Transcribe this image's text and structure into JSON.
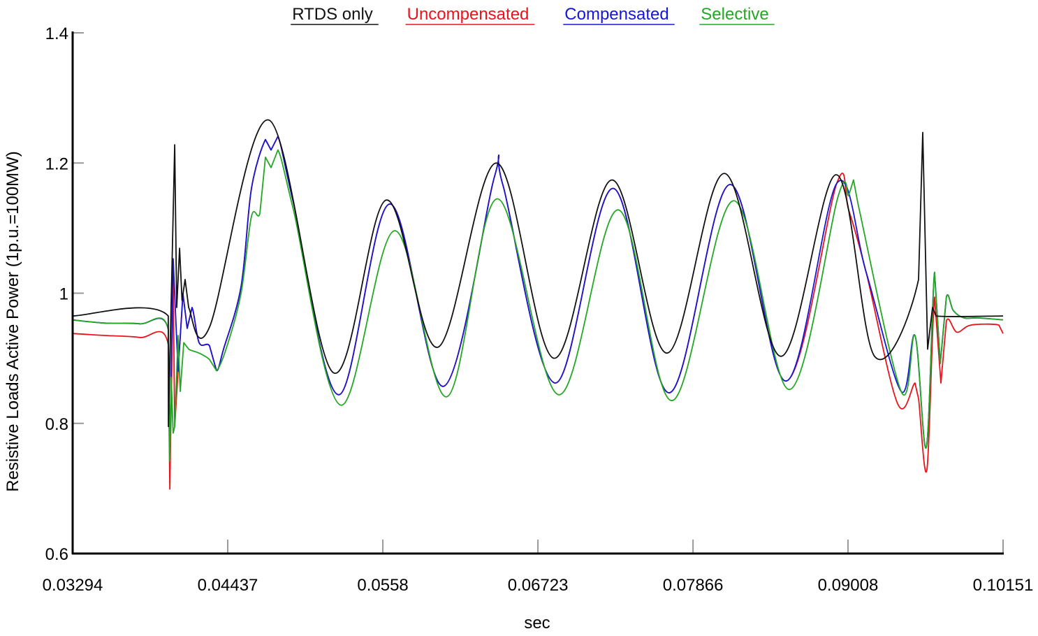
{
  "chart_data": {
    "type": "line",
    "title": "",
    "xlabel": "sec",
    "ylabel": "Resistive Loads Active Power (1p.u.=100MW)",
    "xlim": [
      0.03294,
      0.10151
    ],
    "ylim": [
      0.6,
      1.4
    ],
    "x_ticks": [
      "0.03294",
      "0.04437",
      "0.0558",
      "0.06723",
      "0.07866",
      "0.09008",
      "0.10151"
    ],
    "x_tick_values": [
      0.03294,
      0.04437,
      0.0558,
      0.06723,
      0.07866,
      0.09008,
      0.10151
    ],
    "y_ticks": [
      "0.6",
      "0.8",
      "1",
      "1.2",
      "1.4"
    ],
    "y_tick_values": [
      0.6,
      0.8,
      1.0,
      1.2,
      1.4
    ],
    "grid": false,
    "legend_position": "top-center",
    "series": [
      {
        "name": "Uncompensated",
        "color": "#e8141c",
        "points": [
          [
            0.03294,
            0.938
          ],
          [
            0.03531,
            0.935
          ],
          [
            0.03788,
            0.932
          ],
          [
            0.03999,
            0.921
          ],
          [
            0.0401,
            0.699
          ],
          [
            0.04035,
            1.021
          ],
          [
            0.04046,
            0.795
          ],
          [
            0.04071,
            0.88
          ],
          [
            0.04107,
            0.999
          ],
          [
            0.04138,
            0.946
          ],
          [
            0.04174,
            0.978
          ],
          [
            0.04226,
            0.924
          ],
          [
            0.04303,
            0.919
          ],
          [
            0.04354,
            0.881
          ],
          [
            0.04406,
            0.914
          ],
          [
            0.04535,
            1.01
          ],
          [
            0.04612,
            1.161
          ],
          [
            0.04715,
            1.236
          ],
          [
            0.04756,
            1.22
          ],
          [
            0.04807,
            1.241
          ],
          [
            0.04921,
            1.139
          ],
          [
            0.05255,
            0.844
          ],
          [
            0.05631,
            1.137
          ],
          [
            0.06028,
            0.857
          ],
          [
            0.06403,
            1.179
          ],
          [
            0.06465,
            1.166
          ],
          [
            0.06851,
            0.862
          ],
          [
            0.07278,
            1.161
          ],
          [
            0.0769,
            0.847
          ],
          [
            0.08138,
            1.167
          ],
          [
            0.0855,
            0.865
          ],
          [
            0.08926,
            1.169
          ],
          [
            0.09013,
            1.128
          ],
          [
            0.09142,
            1.032
          ],
          [
            0.09374,
            0.83
          ],
          [
            0.09502,
            0.862
          ],
          [
            0.09528,
            0.838
          ],
          [
            0.0959,
            0.729
          ],
          [
            0.09646,
            0.994
          ],
          [
            0.09693,
            0.862
          ],
          [
            0.09733,
            0.957
          ],
          [
            0.09811,
            0.94
          ],
          [
            0.09914,
            0.951
          ],
          [
            0.1012,
            0.951
          ],
          [
            0.10151,
            0.938
          ]
        ]
      },
      {
        "name": "Compensated",
        "color": "#1616d6",
        "points": [
          [
            0.03294,
            0.959
          ],
          [
            0.03531,
            0.954
          ],
          [
            0.03788,
            0.953
          ],
          [
            0.03999,
            0.944
          ],
          [
            0.0401,
            0.75
          ],
          [
            0.04035,
            1.053
          ],
          [
            0.04071,
            0.88
          ],
          [
            0.04107,
            0.999
          ],
          [
            0.04138,
            0.946
          ],
          [
            0.04174,
            0.978
          ],
          [
            0.04226,
            0.924
          ],
          [
            0.04303,
            0.919
          ],
          [
            0.04354,
            0.881
          ],
          [
            0.04406,
            0.914
          ],
          [
            0.04535,
            1.01
          ],
          [
            0.04612,
            1.161
          ],
          [
            0.04715,
            1.236
          ],
          [
            0.04756,
            1.22
          ],
          [
            0.04807,
            1.241
          ],
          [
            0.04921,
            1.139
          ],
          [
            0.05255,
            0.844
          ],
          [
            0.05631,
            1.137
          ],
          [
            0.06028,
            0.857
          ],
          [
            0.06403,
            1.179
          ],
          [
            0.06465,
            1.166
          ],
          [
            0.06851,
            0.862
          ],
          [
            0.07278,
            1.161
          ],
          [
            0.0769,
            0.847
          ],
          [
            0.08138,
            1.167
          ],
          [
            0.0855,
            0.865
          ],
          [
            0.08926,
            1.169
          ],
          [
            0.09142,
            1.032
          ],
          [
            0.094,
            0.849
          ],
          [
            0.09502,
            0.935
          ],
          [
            0.09585,
            0.763
          ],
          [
            0.09646,
            1.032
          ],
          [
            0.09688,
            0.892
          ],
          [
            0.09733,
            0.994
          ],
          [
            0.09785,
            0.973
          ],
          [
            0.09863,
            0.962
          ],
          [
            0.09966,
            0.962
          ],
          [
            0.10151,
            0.959
          ]
        ]
      },
      {
        "name": "Selective",
        "color": "#22a822",
        "points": [
          [
            0.03294,
            0.959
          ],
          [
            0.03531,
            0.954
          ],
          [
            0.03788,
            0.953
          ],
          [
            0.03999,
            0.944
          ],
          [
            0.0401,
            0.742
          ],
          [
            0.0402,
            0.871
          ],
          [
            0.04035,
            0.785
          ],
          [
            0.04046,
            0.795
          ],
          [
            0.04071,
            0.935
          ],
          [
            0.04087,
            0.849
          ],
          [
            0.04113,
            0.924
          ],
          [
            0.04149,
            0.914
          ],
          [
            0.04226,
            0.908
          ],
          [
            0.04303,
            0.898
          ],
          [
            0.04354,
            0.881
          ],
          [
            0.04432,
            0.919
          ],
          [
            0.04535,
            1.0
          ],
          [
            0.04612,
            1.118
          ],
          [
            0.04674,
            1.123
          ],
          [
            0.04715,
            1.209
          ],
          [
            0.04756,
            1.193
          ],
          [
            0.04807,
            1.22
          ],
          [
            0.04921,
            1.128
          ],
          [
            0.05271,
            0.828
          ],
          [
            0.05667,
            1.096
          ],
          [
            0.06053,
            0.841
          ],
          [
            0.06424,
            1.145
          ],
          [
            0.06877,
            0.844
          ],
          [
            0.07314,
            1.128
          ],
          [
            0.07711,
            0.835
          ],
          [
            0.08164,
            1.142
          ],
          [
            0.08576,
            0.852
          ],
          [
            0.08937,
            1.15
          ],
          [
            0.09013,
            1.15
          ],
          [
            0.09049,
            1.174
          ],
          [
            0.0908,
            1.139
          ],
          [
            0.094,
            0.849
          ],
          [
            0.09502,
            0.935
          ],
          [
            0.09585,
            0.763
          ],
          [
            0.09646,
            1.032
          ],
          [
            0.09688,
            0.892
          ],
          [
            0.09733,
            0.994
          ],
          [
            0.09785,
            0.973
          ],
          [
            0.09863,
            0.962
          ],
          [
            0.09966,
            0.962
          ],
          [
            0.10151,
            0.959
          ]
        ]
      },
      {
        "name": "RTDS only",
        "color": "#111111",
        "points": [
          [
            0.03294,
            0.965
          ],
          [
            0.03999,
            0.965
          ],
          [
            0.04,
            0.795
          ],
          [
            0.04046,
            1.228
          ],
          [
            0.04061,
            0.978
          ],
          [
            0.04082,
            1.069
          ],
          [
            0.041,
            0.989
          ],
          [
            0.04123,
            1.021
          ],
          [
            0.04149,
            0.978
          ],
          [
            0.04303,
            0.948
          ],
          [
            0.04741,
            1.266
          ],
          [
            0.05214,
            0.878
          ],
          [
            0.05605,
            1.143
          ],
          [
            0.05986,
            0.917
          ],
          [
            0.06419,
            1.2
          ],
          [
            0.06841,
            0.9
          ],
          [
            0.07268,
            1.174
          ],
          [
            0.07675,
            0.908
          ],
          [
            0.08097,
            1.184
          ],
          [
            0.08514,
            0.903
          ],
          [
            0.08921,
            1.182
          ],
          [
            0.09204,
            0.903
          ],
          [
            0.09528,
            1.021
          ],
          [
            0.09559,
            1.247
          ],
          [
            0.09595,
            0.914
          ],
          [
            0.09631,
            0.978
          ],
          [
            0.09657,
            0.965
          ],
          [
            0.10151,
            0.965
          ]
        ]
      }
    ],
    "legend": [
      "RTDS only",
      "Uncompensated",
      "Compensated",
      "Selective"
    ]
  }
}
